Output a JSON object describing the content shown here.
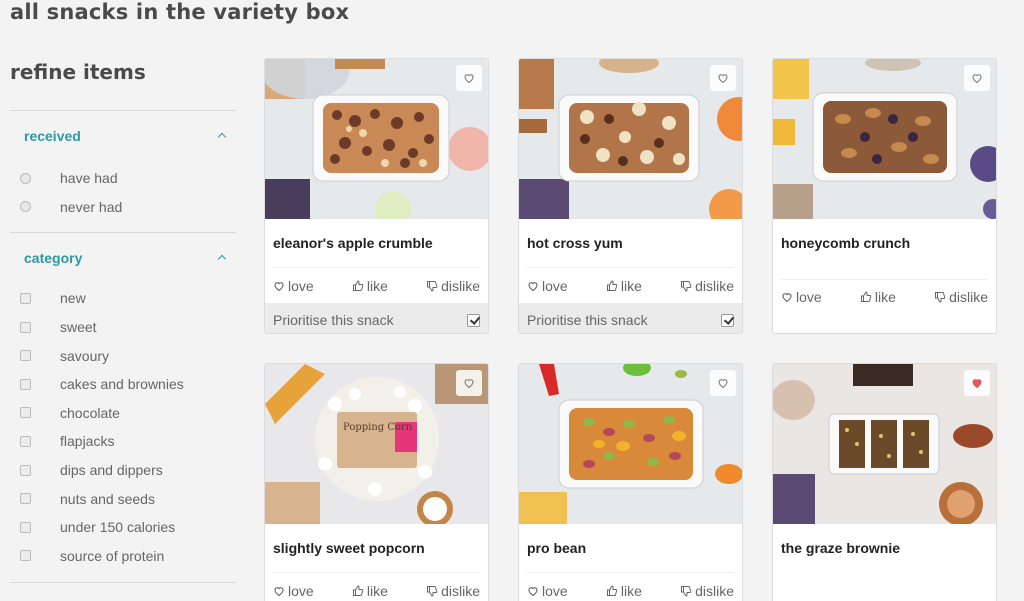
{
  "page": {
    "title": "all snacks in the variety box"
  },
  "sidebar": {
    "title": "refine items",
    "received": {
      "label": "received",
      "options": [
        "have had",
        "never had"
      ]
    },
    "category": {
      "label": "category",
      "options": [
        "new",
        "sweet",
        "savoury",
        "cakes and brownies",
        "chocolate",
        "flapjacks",
        "dips and dippers",
        "nuts and seeds",
        "under 150 calories",
        "source of protein"
      ]
    }
  },
  "ratings": {
    "love": "love",
    "like": "like",
    "dislike": "dislike"
  },
  "prioritise_label": "Prioritise this snack",
  "cards": [
    {
      "name": "eleanor's apple crumble",
      "favourited": false,
      "prioritised": true
    },
    {
      "name": "hot cross yum",
      "favourited": false,
      "prioritised": true
    },
    {
      "name": "honeycomb crunch",
      "favourited": false
    },
    {
      "name": "slightly sweet popcorn",
      "favourited": false,
      "packet_text": "Popping Corn"
    },
    {
      "name": "pro bean",
      "favourited": false
    },
    {
      "name": "the graze brownie",
      "favourited": true
    }
  ],
  "colors": {
    "accent": "#2c9aa0",
    "heart_active": "#e05a5a"
  }
}
